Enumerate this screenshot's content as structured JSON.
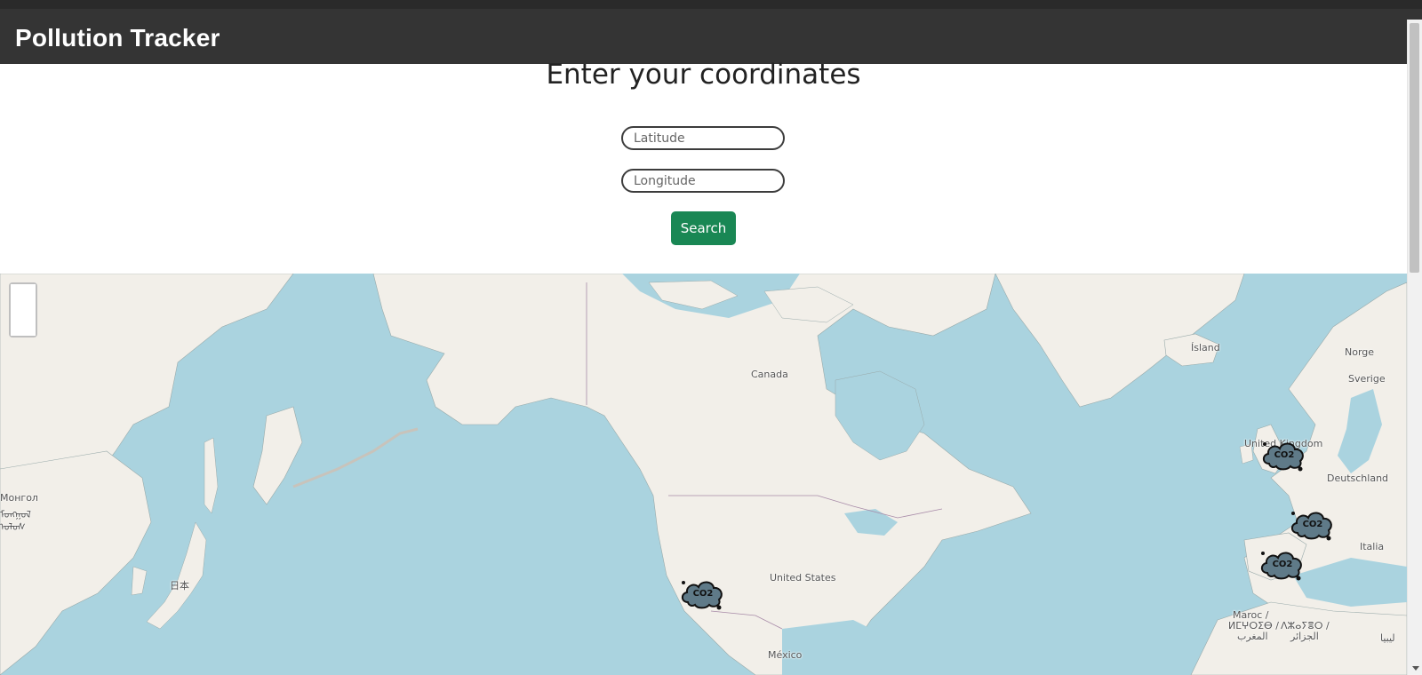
{
  "navbar": {
    "brand": "Pollution Tracker"
  },
  "form": {
    "heading": "Enter your coordinates",
    "latitude_placeholder": "Latitude",
    "longitude_placeholder": "Longitude",
    "search_label": "Search"
  },
  "map": {
    "zoom_in_label": "",
    "zoom_out_label": "",
    "labels": {
      "canada": "Canada",
      "united_states": "United States",
      "mexico": "México",
      "iceland": "Ísland",
      "norway": "Norge",
      "sweden": "Sverige",
      "united_kingdom": "United Kingdom",
      "germany": "Deutschland",
      "italy": "Italia",
      "japan": "日本",
      "mongolia": "Монгол",
      "mongolia_script1": "ᠮᠣᠩᠭᠣᠯ",
      "mongolia_script2": "ᠤᠯᠤᠰ",
      "morocco": "Maroc /",
      "morocco_tifinagh": "ⵍⵎⵖⵔⵉⴱ /",
      "morocco_arabic": "المغرب",
      "algeria_tifinagh": "ⴷⵣⴰⵢⴻⵔ /",
      "algeria_arabic": "الجزائر",
      "libya": "ليبيا"
    },
    "marker_label": "CO2",
    "markers": [
      "California",
      "United Kingdom",
      "France",
      "Spain"
    ]
  }
}
